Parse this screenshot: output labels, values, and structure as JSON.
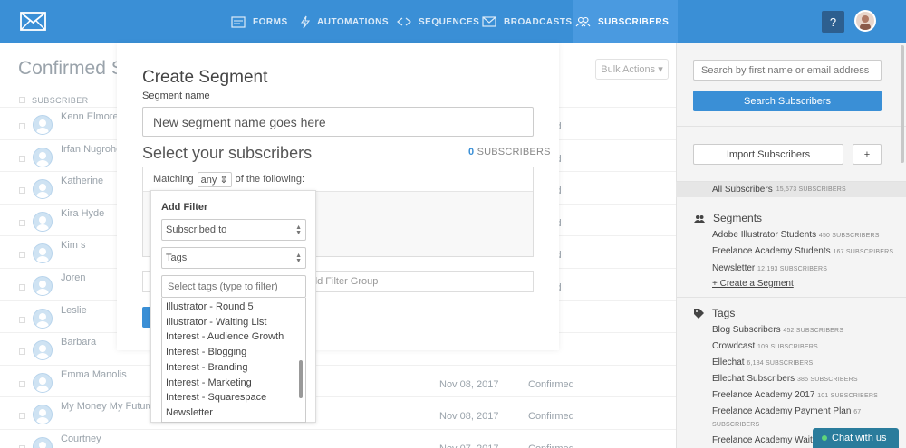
{
  "nav": {
    "items": [
      {
        "label": "FORMS",
        "icon": "forms-icon"
      },
      {
        "label": "AUTOMATIONS",
        "icon": "lightning-icon"
      },
      {
        "label": "SEQUENCES",
        "icon": "sequences-icon"
      },
      {
        "label": "BROADCASTS",
        "icon": "envelope-icon"
      },
      {
        "label": "SUBSCRIBERS",
        "icon": "people-icon",
        "active": true
      }
    ],
    "help_label": "?"
  },
  "main": {
    "title": "Confirmed S",
    "bulk_actions": "Bulk Actions ▾",
    "column_header": "SUBSCRIBER",
    "rows": [
      {
        "name": "Kenn Elmore",
        "date": "",
        "status": "nfirmed"
      },
      {
        "name": "Irfan Nugroho",
        "date": "",
        "status": "nfirmed"
      },
      {
        "name": "Katherine",
        "date": "",
        "status": "nfirmed"
      },
      {
        "name": "Kira Hyde",
        "date": "",
        "status": "nfirmed"
      },
      {
        "name": "Kim s",
        "date": "",
        "status": "nfirmed"
      },
      {
        "name": "Joren",
        "date": "",
        "status": "nfirmed"
      },
      {
        "name": "Leslie",
        "date": "",
        "status": ""
      },
      {
        "name": "Barbara",
        "date": "",
        "status": ""
      },
      {
        "name": "Emma Manolis",
        "date": "Nov 08, 2017",
        "status": "Confirmed"
      },
      {
        "name": "My Money My Future",
        "date": "Nov 08, 2017",
        "status": "Confirmed"
      },
      {
        "name": "Courtney",
        "date": "Nov 07, 2017",
        "status": "Confirmed"
      }
    ]
  },
  "modal": {
    "title": "Create Segment",
    "segment_name_label": "Segment name",
    "segment_name_value": "New segment name goes here",
    "select_title": "Select your subscribers",
    "subscriber_count": "0",
    "subscriber_count_label": "SUBSCRIBERS",
    "matching_prefix": "Matching",
    "matching_value": "any ⇕",
    "matching_suffix": "of the following:",
    "add_filter_group": "dd Filter Group"
  },
  "filter_popover": {
    "title": "Add Filter",
    "type_select": "Subscribed to",
    "category_select": "Tags",
    "tag_placeholder": "Select tags (type to filter)",
    "tags": [
      "Illustrator - Round 5",
      "Illustrator - Waiting List",
      "Interest - Audience Growth",
      "Interest - Blogging",
      "Interest - Branding",
      "Interest - Marketing",
      "Interest - Squarespace",
      "Newsletter"
    ]
  },
  "sidebar": {
    "search_placeholder": "Search by first name or email address",
    "search_button": "Search Subscribers",
    "import_button": "Import Subscribers",
    "plus_button": "+",
    "all_subscribers": "All Subscribers",
    "all_subscribers_count": "15,573 SUBSCRIBERS",
    "segments_heading": "Segments",
    "segments": [
      {
        "name": "Adobe Illustrator Students",
        "count": "450 SUBSCRIBERS"
      },
      {
        "name": "Freelance Academy Students",
        "count": "167 SUBSCRIBERS"
      },
      {
        "name": "Newsletter",
        "count": "12,193 SUBSCRIBERS"
      }
    ],
    "create_segment": "+ Create a Segment",
    "tags_heading": "Tags",
    "tags": [
      {
        "name": "Blog Subscribers",
        "count": "452 SUBSCRIBERS"
      },
      {
        "name": "Crowdcast",
        "count": "109 SUBSCRIBERS"
      },
      {
        "name": "Ellechat",
        "count": "6,184 SUBSCRIBERS"
      },
      {
        "name": "Ellechat Subscribers",
        "count": "385 SUBSCRIBERS"
      },
      {
        "name": "Freelance Academy 2017",
        "count": "101 SUBSCRIBERS"
      },
      {
        "name": "Freelance Academy Payment Plan",
        "count": "67"
      },
      {
        "name": "",
        "count": "SUBSCRIBERS"
      },
      {
        "name": "Freelance Academy Wait",
        "count": ""
      }
    ]
  },
  "chat": {
    "label": "Chat with us"
  },
  "colors": {
    "brand": "#3a8fd6",
    "chat": "#2a7c9c"
  }
}
